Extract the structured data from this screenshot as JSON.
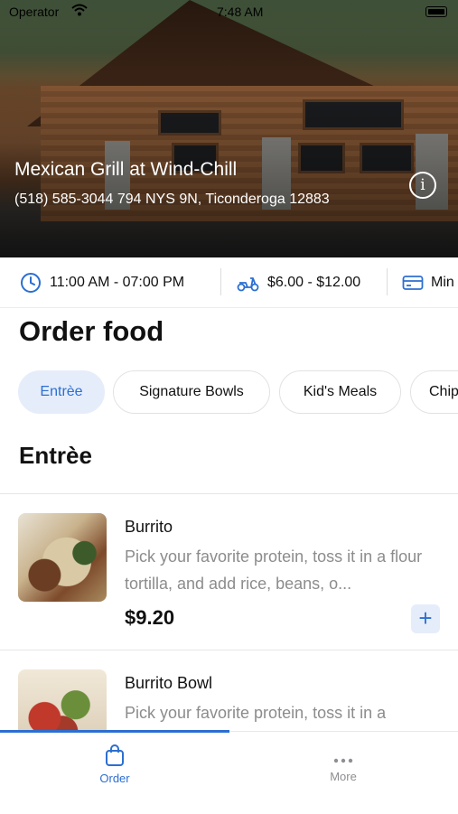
{
  "status_bar": {
    "carrier": "Operator",
    "time": "7:48 AM"
  },
  "restaurant": {
    "name": "Mexican Grill at Wind-Chill",
    "address": "(518) 585-3044 794 NYS 9N, Ticonderoga 12883"
  },
  "info": {
    "hours": "11:00 AM - 07:00 PM",
    "delivery_fee": "$6.00 - $12.00",
    "min_order": "Min"
  },
  "page_title": "Order food",
  "categories": [
    "Entrèe",
    "Signature Bowls",
    "Kid's Meals",
    "Chips"
  ],
  "section_title": "Entrèe",
  "menu_items": [
    {
      "name": "Burrito",
      "description": "Pick your favorite protein, toss it in a flour tortilla, and add rice, beans, o...",
      "price": "$9.20"
    },
    {
      "name": "Burrito Bowl",
      "description": "Pick your favorite protein, toss it in a",
      "price": ""
    }
  ],
  "tabs": {
    "order": "Order",
    "more": "More"
  },
  "colors": {
    "accent": "#2c6fd1",
    "chip_active_bg": "#e6edfa"
  }
}
